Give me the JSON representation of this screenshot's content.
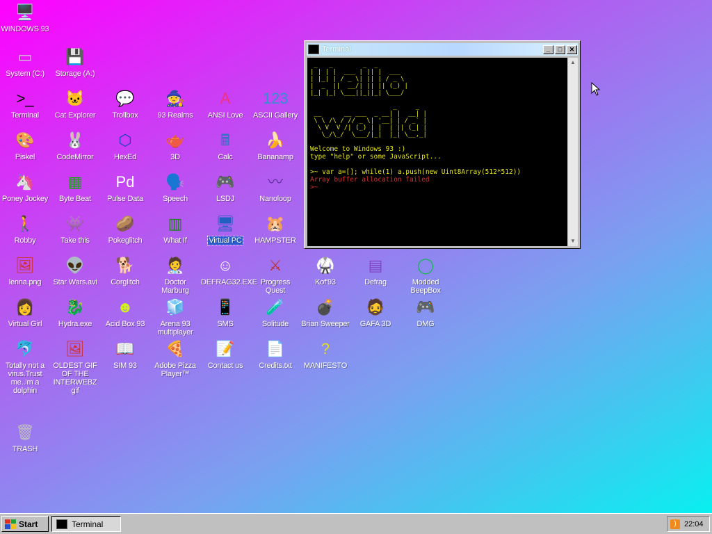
{
  "desktop": {
    "icons": [
      {
        "label": "WINDOWS 93",
        "glyph": "🖥️",
        "color": "#c0c0c0"
      },
      {
        "label": "System (C:)",
        "glyph": "▭",
        "color": "#d0d0d0"
      },
      {
        "label": "Storage (A:)",
        "glyph": "💾",
        "color": "#d0d0d0"
      },
      {
        "label": "Terminal",
        "glyph": ">_",
        "color": "#000000"
      },
      {
        "label": "Cat Explorer",
        "glyph": "🐱",
        "color": "#4a90d0"
      },
      {
        "label": "Trollbox",
        "glyph": "💬",
        "color": "#f0c020"
      },
      {
        "label": "93 Realms",
        "glyph": "🧙",
        "color": "#d03030"
      },
      {
        "label": "ANSI Love",
        "glyph": "A",
        "color": "#f03080"
      },
      {
        "label": "ASCII Gallery",
        "glyph": "123",
        "color": "#3090d0"
      },
      {
        "label": "Piskel",
        "glyph": "🎨",
        "color": "#c080f0"
      },
      {
        "label": "CodeMirror",
        "glyph": "🐰",
        "color": "#d03030"
      },
      {
        "label": "HexEd",
        "glyph": "⬡",
        "color": "#2040c0"
      },
      {
        "label": "3D",
        "glyph": "🫖",
        "color": "#f08080"
      },
      {
        "label": "Calc",
        "glyph": "🖩",
        "color": "#3070c0"
      },
      {
        "label": "Bananamp",
        "glyph": "🍌",
        "color": "#f0d020"
      },
      {
        "label": "Poney Jockey",
        "glyph": "🦄",
        "color": "#a050d0"
      },
      {
        "label": "Byte Beat",
        "glyph": "▦",
        "color": "#20a020"
      },
      {
        "label": "Pulse Data",
        "glyph": "Pd",
        "color": "#ffffff"
      },
      {
        "label": "Speech",
        "glyph": "🗣️",
        "color": "#c0c0c0"
      },
      {
        "label": "LSDJ",
        "glyph": "🎮",
        "color": "#8040c0"
      },
      {
        "label": "Nanoloop",
        "glyph": "〰",
        "color": "#6030a0"
      },
      {
        "label": "Robby",
        "glyph": "🚶",
        "color": "#ffffff"
      },
      {
        "label": "Take this",
        "glyph": "👾",
        "color": "#f06020"
      },
      {
        "label": "Pokeglitch",
        "glyph": "🥔",
        "color": "#b08040"
      },
      {
        "label": "What If",
        "glyph": "▥",
        "color": "#208020"
      },
      {
        "label": "Virtual PC",
        "glyph": "🖥",
        "color": "#2060c0",
        "selected": true
      },
      {
        "label": "HAMPSTER",
        "glyph": "🐹",
        "color": "#c0a080"
      },
      {
        "label": "lenna.png",
        "glyph": "🖼",
        "color": "#d03030"
      },
      {
        "label": "Star Wars.avi",
        "glyph": "👽",
        "color": "#40a040"
      },
      {
        "label": "Corglitch",
        "glyph": "🐕",
        "color": "#e09040"
      },
      {
        "label": "Doctor Marburg",
        "glyph": "🧑‍⚕️",
        "color": "#f0a0a0"
      },
      {
        "label": "DEFRAG32.EXE",
        "glyph": "☺",
        "color": "#ffffff"
      },
      {
        "label": "Progress Quest",
        "glyph": "⚔",
        "color": "#c03030"
      },
      {
        "label": "Kof'93",
        "glyph": "🥋",
        "color": "#d04040"
      },
      {
        "label": "Defrag",
        "glyph": "▤",
        "color": "#8040c0"
      },
      {
        "label": "Modded BeepBox",
        "glyph": "◯",
        "color": "#20b060"
      },
      {
        "label": "Virtual Girl",
        "glyph": "👩",
        "color": "#f0c0a0"
      },
      {
        "label": "Hydra.exe",
        "glyph": "🐉",
        "color": "#30a040"
      },
      {
        "label": "Acid Box 93",
        "glyph": "☻",
        "color": "#d0f020"
      },
      {
        "label": "Arena 93 multiplayer",
        "glyph": "🧊",
        "color": "#40a0d0"
      },
      {
        "label": "SMS",
        "glyph": "📱",
        "color": "#c03030"
      },
      {
        "label": "Solitude",
        "glyph": "🧪",
        "color": "#40c0a0"
      },
      {
        "label": "Brian Sweeper",
        "glyph": "💣",
        "color": "#6040a0"
      },
      {
        "label": "GAFA 3D",
        "glyph": "🧔",
        "color": "#d09060"
      },
      {
        "label": "DMG",
        "glyph": "🎮",
        "color": "#c0c0c0"
      },
      {
        "label": "Totally not a virus.Trust me..im a dolphin",
        "glyph": "🐬",
        "color": "#30a0d0"
      },
      {
        "label": "OLDEST GIF OF THE INTERWEBZ gif",
        "glyph": "🖼",
        "color": "#d03030"
      },
      {
        "label": "SIM 93",
        "glyph": "📖",
        "color": "#c0c0c0"
      },
      {
        "label": "Adobe Pizza Player™",
        "glyph": "🍕",
        "color": "#e0a040"
      },
      {
        "label": "Contact us",
        "glyph": "📝",
        "color": "#ffffff"
      },
      {
        "label": "Credits.txt",
        "glyph": "📄",
        "color": "#ffffff"
      },
      {
        "label": "MANIFESTO",
        "glyph": "?",
        "color": "#e0e020"
      },
      {
        "label": "TRASH",
        "glyph": "🗑",
        "color": "#c0c0c0"
      }
    ]
  },
  "window": {
    "title": "Terminal",
    "minimize": "_",
    "maximize": "□",
    "close": "✕",
    "ascii_art": " _   _        _  _\n| | | |  ___ | || |  ___\n| |_| | / _ \\| || | / _ \\\n|  _  ||  __/| || || (_) |\n|_| |_| \\___||_||_| \\___/\n\n                      _     _\n __      __ ___  _ __| |  __| |\n \\ \\ /\\ / // _ \\| '__| | / _` |\n  \\ V  V /| (_) | |  | || (_| |\n   \\_/\\_/  \\___/|_|  |_| \\__,_|",
    "welcome_line1": "Welcome to Windows 93 :)",
    "welcome_line2": "type \"help\" or some JavaScript...",
    "command": ">~ var a=[]; while(1) a.push(new Uint8Array(512*512))",
    "error": "Array buffer allocation failed",
    "prompt": ">~"
  },
  "taskbar": {
    "start_label": "Start",
    "task_label": "Terminal",
    "clock": "22:04"
  }
}
